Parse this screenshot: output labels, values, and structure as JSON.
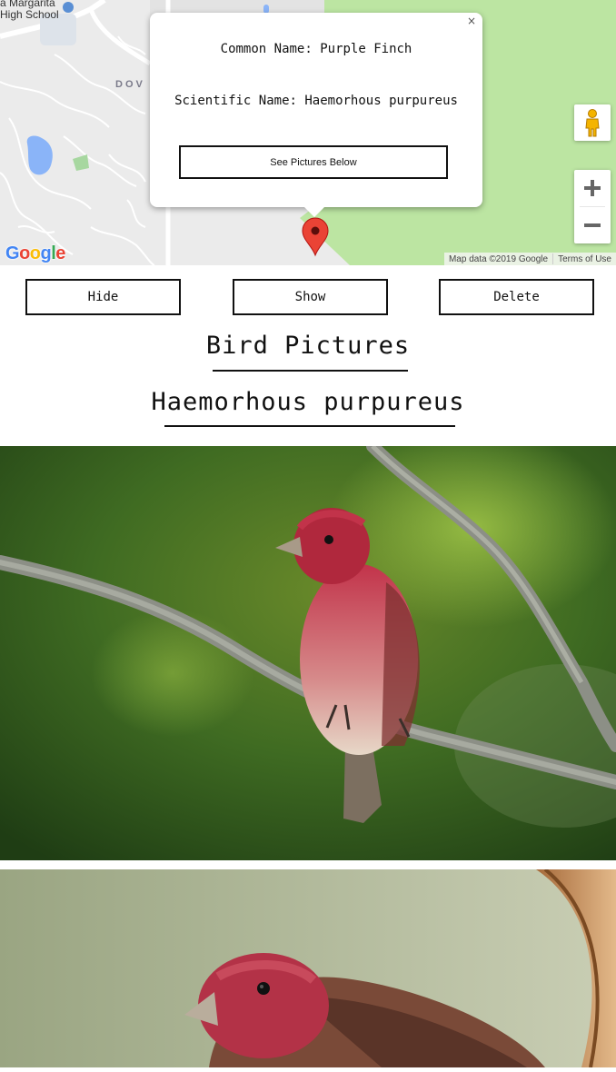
{
  "map": {
    "place_label": "a Margarita\nHigh School",
    "area_label": "DOV",
    "popup": {
      "common_name": "Common Name: Purple Finch",
      "scientific_name": "Scientific Name: Haemorhous purpureus",
      "button_label": "See Pictures Below",
      "close_glyph": "×"
    },
    "zoom_in_glyph": "+",
    "zoom_out_glyph": "−",
    "attribution": "Map data ©2019 Google",
    "terms": "Terms of Use",
    "logo_letters": [
      "G",
      "o",
      "o",
      "g",
      "l",
      "e"
    ],
    "logo_colors": [
      "#4285F4",
      "#EA4335",
      "#FBBC05",
      "#4285F4",
      "#34A853",
      "#EA4335"
    ],
    "marker_color": "#ea4335",
    "park_color": "#bce5a2"
  },
  "controls": {
    "hide_label": "Hide",
    "show_label": "Show",
    "delete_label": "Delete"
  },
  "section": {
    "title": "Bird Pictures",
    "species": "Haemorhous purpureus"
  },
  "photos": {
    "count": 2,
    "subject": "Purple Finch"
  }
}
